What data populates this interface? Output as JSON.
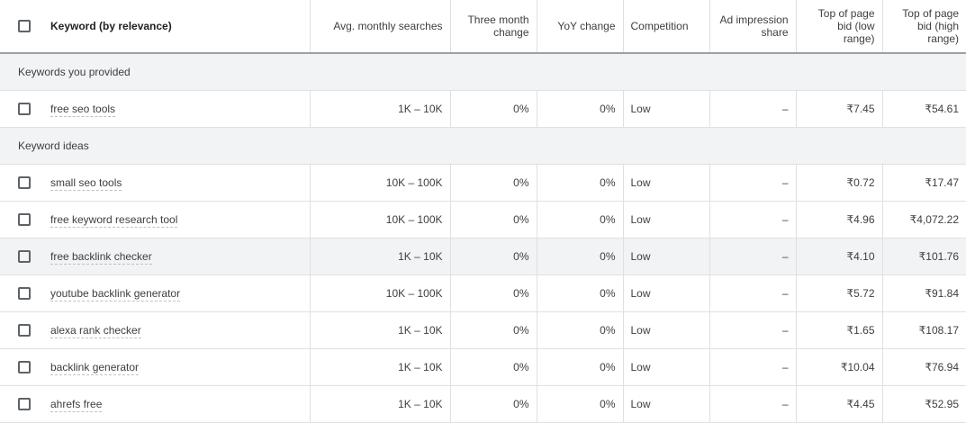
{
  "header": {
    "keyword": "Keyword (by relevance)",
    "avg_searches": "Avg. monthly searches",
    "three_month": "Three month change",
    "yoy": "YoY change",
    "competition": "Competition",
    "ad_impression": "Ad impression share",
    "bid_low": "Top of page bid (low range)",
    "bid_high": "Top of page bid (high range)"
  },
  "groups": {
    "provided": "Keywords you provided",
    "ideas": "Keyword ideas"
  },
  "provided_rows": [
    {
      "keyword": "free seo tools",
      "searches": "1K – 10K",
      "three_month": "0%",
      "yoy": "0%",
      "competition": "Low",
      "impression": "–",
      "bid_low": "₹7.45",
      "bid_high": "₹54.61"
    }
  ],
  "idea_rows": [
    {
      "keyword": "small seo tools",
      "searches": "10K – 100K",
      "three_month": "0%",
      "yoy": "0%",
      "competition": "Low",
      "impression": "–",
      "bid_low": "₹0.72",
      "bid_high": "₹17.47"
    },
    {
      "keyword": "free keyword research tool",
      "searches": "10K – 100K",
      "three_month": "0%",
      "yoy": "0%",
      "competition": "Low",
      "impression": "–",
      "bid_low": "₹4.96",
      "bid_high": "₹4,072.22"
    },
    {
      "keyword": "free backlink checker",
      "searches": "1K – 10K",
      "three_month": "0%",
      "yoy": "0%",
      "competition": "Low",
      "impression": "–",
      "bid_low": "₹4.10",
      "bid_high": "₹101.76"
    },
    {
      "keyword": "youtube backlink generator",
      "searches": "10K – 100K",
      "three_month": "0%",
      "yoy": "0%",
      "competition": "Low",
      "impression": "–",
      "bid_low": "₹5.72",
      "bid_high": "₹91.84"
    },
    {
      "keyword": "alexa rank checker",
      "searches": "1K – 10K",
      "three_month": "0%",
      "yoy": "0%",
      "competition": "Low",
      "impression": "–",
      "bid_low": "₹1.65",
      "bid_high": "₹108.17"
    },
    {
      "keyword": "backlink generator",
      "searches": "1K – 10K",
      "three_month": "0%",
      "yoy": "0%",
      "competition": "Low",
      "impression": "–",
      "bid_low": "₹10.04",
      "bid_high": "₹76.94"
    },
    {
      "keyword": "ahrefs free",
      "searches": "1K – 10K",
      "three_month": "0%",
      "yoy": "0%",
      "competition": "Low",
      "impression": "–",
      "bid_low": "₹4.45",
      "bid_high": "₹52.95"
    }
  ]
}
